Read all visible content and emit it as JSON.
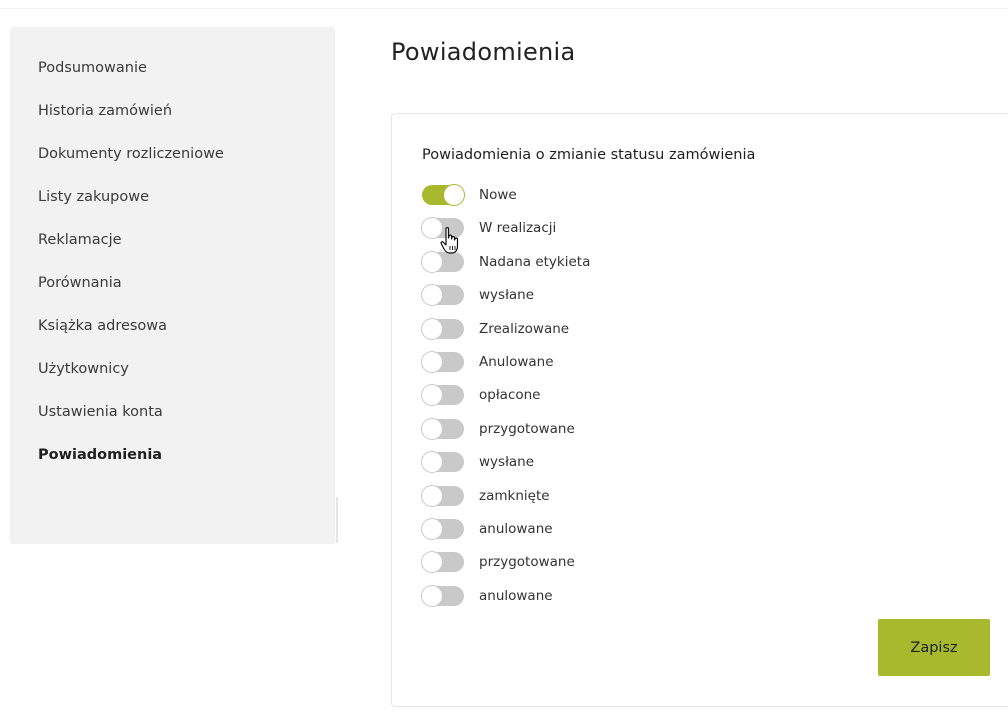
{
  "sidebar": {
    "items": [
      {
        "label": "Podsumowanie"
      },
      {
        "label": "Historia zamówień"
      },
      {
        "label": "Dokumenty rozliczeniowe"
      },
      {
        "label": "Listy zakupowe"
      },
      {
        "label": "Reklamacje"
      },
      {
        "label": "Porównania"
      },
      {
        "label": "Książka adresowa"
      },
      {
        "label": "Użytkownicy"
      },
      {
        "label": "Ustawienia konta"
      },
      {
        "label": "Powiadomienia"
      }
    ],
    "active_index": 9
  },
  "main": {
    "title": "Powiadomienia",
    "section_title": "Powiadomienia o zmianie statusu zamówienia",
    "toggles": [
      {
        "label": "Nowe",
        "on": true
      },
      {
        "label": "W realizacji",
        "on": false
      },
      {
        "label": "Nadana etykieta",
        "on": false
      },
      {
        "label": "wysłane",
        "on": false
      },
      {
        "label": "Zrealizowane",
        "on": false
      },
      {
        "label": "Anulowane",
        "on": false
      },
      {
        "label": "opłacone",
        "on": false
      },
      {
        "label": "przygotowane",
        "on": false
      },
      {
        "label": "wysłane",
        "on": false
      },
      {
        "label": "zamknięte",
        "on": false
      },
      {
        "label": "anulowane",
        "on": false
      },
      {
        "label": "przygotowane",
        "on": false
      },
      {
        "label": "anulowane",
        "on": false
      }
    ],
    "save_label": "Zapisz"
  },
  "colors": {
    "accent": "#a8b92e",
    "toggle_off": "#c9c9c9",
    "sidebar_bg": "#f2f2f2"
  },
  "icons": {
    "cursor": "hand-pointer-icon"
  }
}
